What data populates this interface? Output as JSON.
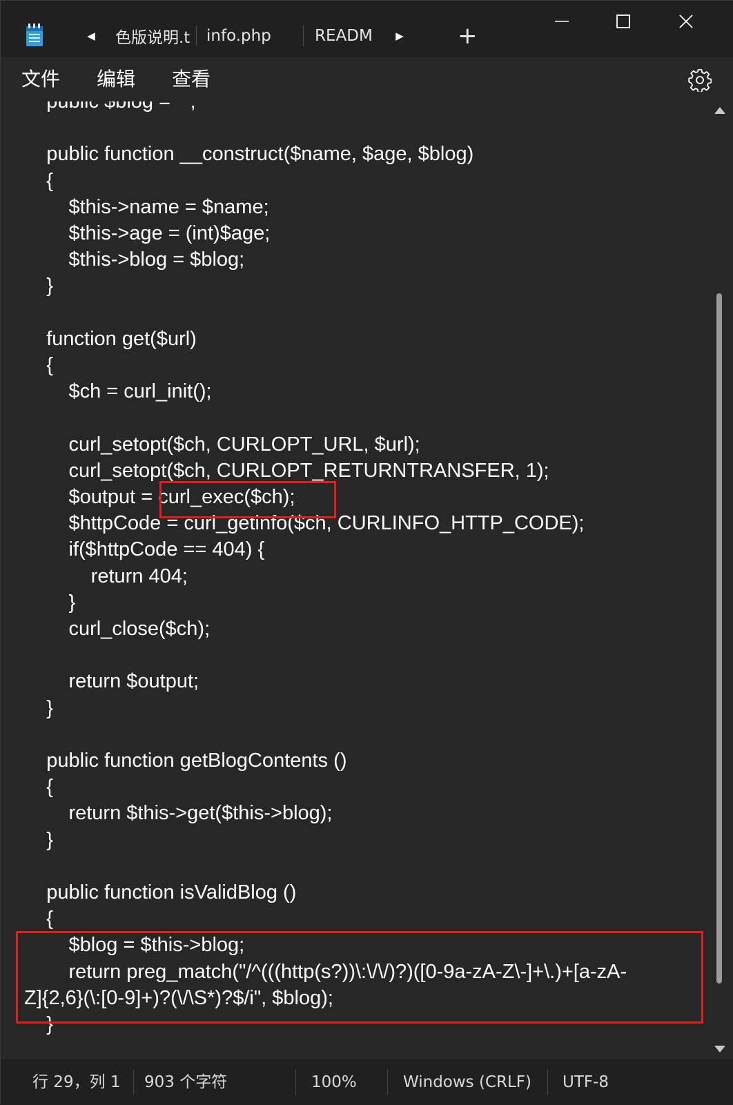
{
  "tabs": [
    {
      "label": "色版说明.t"
    },
    {
      "label": "info.php"
    },
    {
      "label": "README"
    }
  ],
  "new_tab_label": "+",
  "menu": {
    "items": [
      {
        "label": "文件"
      },
      {
        "label": "编辑"
      },
      {
        "label": "查看"
      }
    ]
  },
  "editor": {
    "lines": [
      "    public $blog = \"\";",
      "",
      "    public function __construct($name, $age, $blog)",
      "    {",
      "        $this->name = $name;",
      "        $this->age = (int)$age;",
      "        $this->blog = $blog;",
      "    }",
      "",
      "    function get($url)",
      "    {",
      "        $ch = curl_init();",
      "",
      "        curl_setopt($ch, CURLOPT_URL, $url);",
      "        curl_setopt($ch, CURLOPT_RETURNTRANSFER, 1);",
      "        $output = curl_exec($ch);",
      "        $httpCode = curl_getinfo($ch, CURLINFO_HTTP_CODE);",
      "        if($httpCode == 404) {",
      "            return 404;",
      "        }",
      "        curl_close($ch);",
      "",
      "        return $output;",
      "    }",
      "",
      "    public function getBlogContents ()",
      "    {",
      "        return $this->get($this->blog);",
      "    }",
      "",
      "    public function isValidBlog ()",
      "    {",
      "        $blog = $this->blog;",
      "        return preg_match(\"/^(((http(s?))\\:\\/\\/)?)([0-9a-zA-Z\\-]+\\.)+[a-zA-",
      "Z]{2,6}(\\:[0-9]+)?(\\/\\S*)?$/i\", $blog);",
      "    }"
    ]
  },
  "status": {
    "position": "行 29，列 1",
    "char_count": "903 个字符",
    "zoom": "100%",
    "line_ending": "Windows (CRLF)",
    "encoding": "UTF-8"
  },
  "colors": {
    "background": "#272727",
    "titlebar": "#202020",
    "text": "#ffffff",
    "highlight_box": "#e02020"
  },
  "icons": {
    "app": "notepad-icon",
    "tab_prev": "tab-scroll-left-icon",
    "tab_next": "tab-scroll-right-icon",
    "minimize": "minimize-icon",
    "maximize": "maximize-icon",
    "close": "close-icon",
    "settings": "gear-icon"
  }
}
